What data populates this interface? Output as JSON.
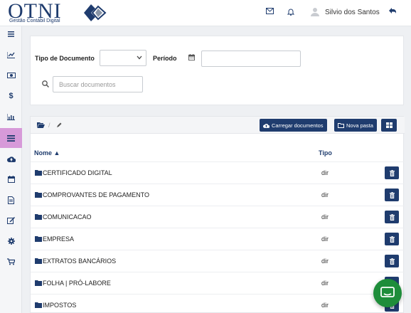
{
  "brand": {
    "logo_text": "OTNI",
    "tagline": "Gestão Contábil Digital",
    "color": "#1f3c6e"
  },
  "header": {
    "user_name": "Silvio dos Santos",
    "icons": [
      "mail-icon",
      "bell-icon",
      "user-avatar-icon",
      "logout-icon"
    ]
  },
  "sidebar": {
    "items": [
      {
        "icon": "menu-icon"
      },
      {
        "icon": "chart-line-icon"
      },
      {
        "icon": "money-icon"
      },
      {
        "icon": "dollar-icon"
      },
      {
        "icon": "bar-chart-icon"
      },
      {
        "icon": "list-icon",
        "active": true
      },
      {
        "icon": "cloud-upload-icon"
      },
      {
        "icon": "calendar-icon"
      },
      {
        "icon": "file-icon"
      },
      {
        "icon": "edit-icon"
      },
      {
        "icon": "gear-icon"
      },
      {
        "icon": "cart-icon"
      }
    ],
    "active_color": "#d79ad9"
  },
  "filters": {
    "doc_type_label": "Tipo de Documento",
    "doc_type_value": "",
    "period_label": "Período",
    "period_value": "",
    "search_placeholder": "Buscar documentos"
  },
  "toolbar": {
    "upload_label": "Carregar documentos",
    "new_folder_label": "Nova pasta"
  },
  "table": {
    "columns": [
      "Nome ▲",
      "Tipo"
    ],
    "rows": [
      {
        "name": "CERTIFICADO DIGITAL",
        "type": "dir"
      },
      {
        "name": "COMPROVANTES DE PAGAMENTO",
        "type": "dir"
      },
      {
        "name": "COMUNICACAO",
        "type": "dir"
      },
      {
        "name": "EMPRESA",
        "type": "dir"
      },
      {
        "name": "EXTRATOS BANCÁRIOS",
        "type": "dir"
      },
      {
        "name": "FOLHA | PRÓ-LABORE",
        "type": "dir"
      },
      {
        "name": "IMPOSTOS",
        "type": "dir"
      }
    ]
  },
  "chat": {
    "icon": "chat-icon",
    "color": "#1e8d3a"
  }
}
